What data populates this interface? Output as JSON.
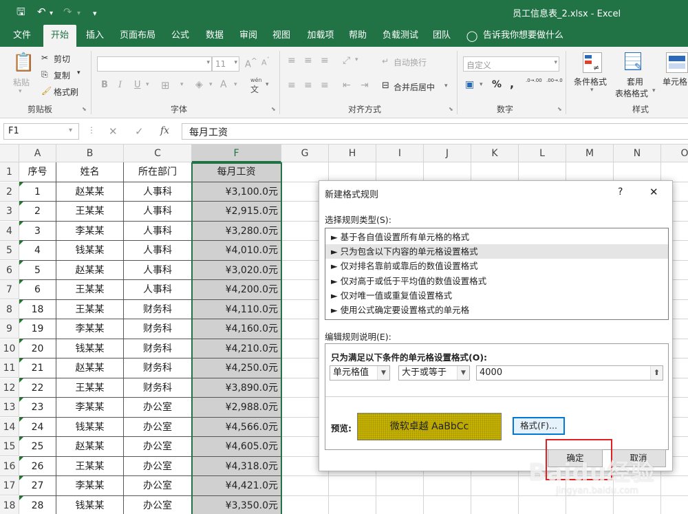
{
  "window": {
    "title": "员工信息表_2.xlsx  -  Excel"
  },
  "ribbon_tabs": [
    "文件",
    "开始",
    "插入",
    "页面布局",
    "公式",
    "数据",
    "审阅",
    "视图",
    "加载项",
    "帮助",
    "负载测试",
    "团队"
  ],
  "active_tab": "开始",
  "tell_me": "告诉我你想要做什么",
  "clipboard": {
    "paste": "粘贴",
    "cut": "剪切",
    "copy": "复制",
    "format_painter": "格式刷",
    "label": "剪贴板"
  },
  "font": {
    "size": "11",
    "bold": "B",
    "italic": "I",
    "underline": "U",
    "wen": "wén",
    "label": "字体"
  },
  "alignment": {
    "wrap": "自动换行",
    "merge": "合并后居中",
    "label": "对齐方式"
  },
  "number": {
    "format": "自定义",
    "percent": "%",
    "comma": ",",
    "label": "数字",
    "inc_decimal": ".0→.00",
    "dec_decimal": ".00→.0"
  },
  "styles": {
    "conditional": "条件格式",
    "table_line1": "套用",
    "table_line2": "表格格式",
    "cell_styles": "单元格",
    "label": "样式"
  },
  "formula_bar": {
    "name_box": "F1",
    "fx": "fx",
    "content": "每月工资"
  },
  "columns": [
    "A",
    "B",
    "C",
    "F",
    "G",
    "H",
    "I",
    "J",
    "K",
    "L",
    "M",
    "N",
    "O"
  ],
  "rows": [
    "1",
    "2",
    "3",
    "4",
    "5",
    "6",
    "7",
    "8",
    "9",
    "10",
    "11",
    "12",
    "13",
    "14",
    "15",
    "16",
    "17",
    "18"
  ],
  "header_row": [
    "序号",
    "姓名",
    "所在部门",
    "每月工资"
  ],
  "data_rows": [
    [
      "1",
      "赵某某",
      "人事科",
      "¥3,100.0元"
    ],
    [
      "2",
      "王某某",
      "人事科",
      "¥2,915.0元"
    ],
    [
      "3",
      "李某某",
      "人事科",
      "¥3,280.0元"
    ],
    [
      "4",
      "钱某某",
      "人事科",
      "¥4,010.0元"
    ],
    [
      "5",
      "赵某某",
      "人事科",
      "¥3,020.0元"
    ],
    [
      "6",
      "王某某",
      "人事科",
      "¥4,200.0元"
    ],
    [
      "18",
      "王某某",
      "财务科",
      "¥4,110.0元"
    ],
    [
      "19",
      "李某某",
      "财务科",
      "¥4,160.0元"
    ],
    [
      "20",
      "钱某某",
      "财务科",
      "¥4,210.0元"
    ],
    [
      "21",
      "赵某某",
      "财务科",
      "¥4,250.0元"
    ],
    [
      "22",
      "王某某",
      "财务科",
      "¥3,890.0元"
    ],
    [
      "23",
      "李某某",
      "办公室",
      "¥2,988.0元"
    ],
    [
      "24",
      "钱某某",
      "办公室",
      "¥4,566.0元"
    ],
    [
      "25",
      "赵某某",
      "办公室",
      "¥4,605.0元"
    ],
    [
      "26",
      "王某某",
      "办公室",
      "¥4,318.0元"
    ],
    [
      "27",
      "李某某",
      "办公室",
      "¥4,421.0元"
    ],
    [
      "28",
      "钱某某",
      "办公室",
      "¥3,350.0元"
    ]
  ],
  "dialog": {
    "title": "新建格式规则",
    "help": "?",
    "close": "✕",
    "rule_type_label": "选择规则类型(S):",
    "rule_types": [
      "► 基于各自值设置所有单元格的格式",
      "► 只为包含以下内容的单元格设置格式",
      "► 仅对排名靠前或靠后的数值设置格式",
      "► 仅对高于或低于平均值的数值设置格式",
      "► 仅对唯一值或重复值设置格式",
      "► 使用公式确定要设置格式的单元格"
    ],
    "selected_rule_index": 1,
    "edit_label": "编辑规则说明(E):",
    "condition_title": "只为满足以下条件的单元格设置格式(O):",
    "condition_type": "单元格值",
    "operator": "大于或等于",
    "value": "4000",
    "preview_label": "预览:",
    "preview_text": "微软卓越  AaBbCc",
    "preview_color": "#c8b400",
    "format_button": "格式(F)...",
    "ok_button": "确定",
    "cancel_button": "取消"
  },
  "colors": {
    "excel_green": "#217346",
    "highlight": "#e02020"
  },
  "watermark": {
    "main": "Baidu经验",
    "sub": "jingyan.baidu.com"
  }
}
